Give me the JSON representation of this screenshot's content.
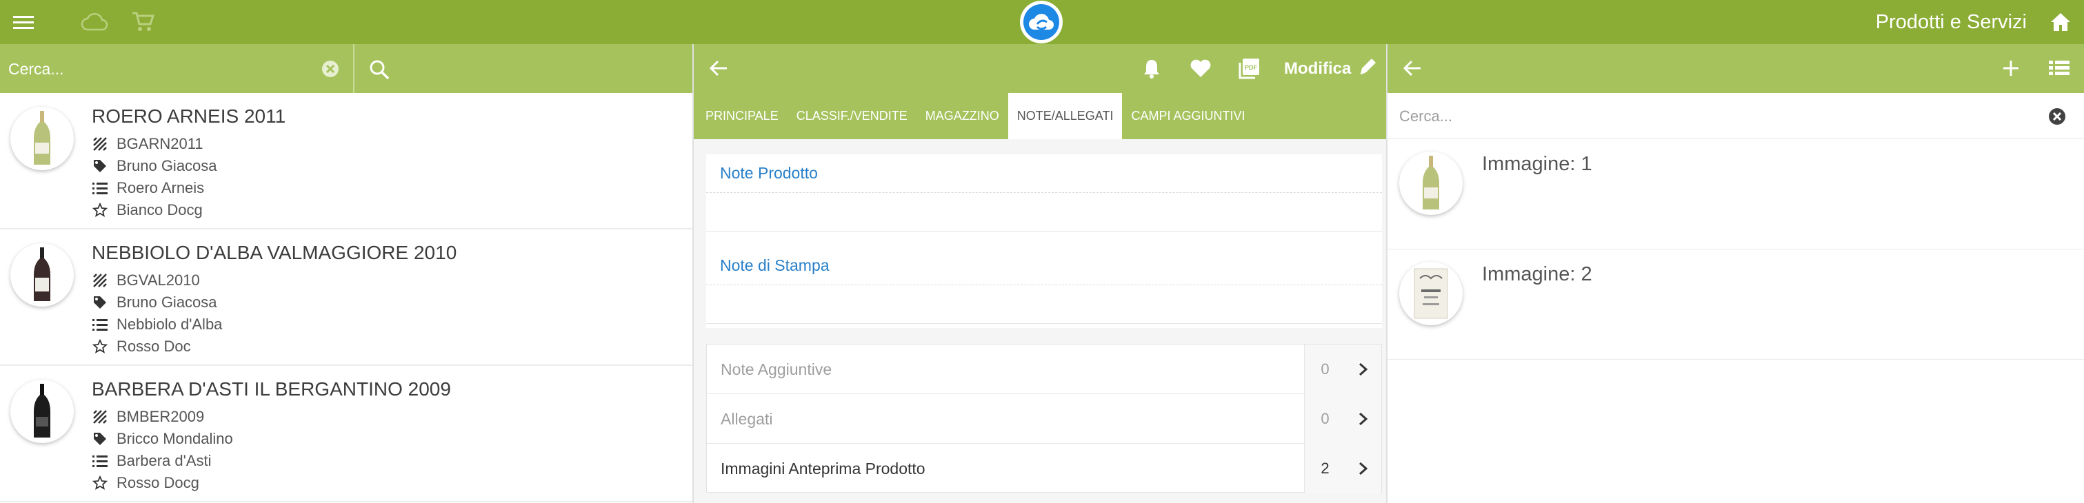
{
  "topbar": {
    "title": "Prodotti e Servizi",
    "icons": [
      "menu-icon",
      "cloud-icon",
      "cart-icon",
      "logo-cloud-icon",
      "home-icon"
    ]
  },
  "left": {
    "search": {
      "placeholder": "Cerca...",
      "value": ""
    },
    "products": [
      {
        "name": "ROERO ARNEIS 2011",
        "code": "BGARN2011",
        "producer": "Bruno Giacosa",
        "category": "Roero Arneis",
        "type": "Bianco Docg",
        "bottle": "white"
      },
      {
        "name": "NEBBIOLO D'ALBA VALMAGGIORE 2010",
        "code": "BGVAL2010",
        "producer": "Bruno Giacosa",
        "category": "Nebbiolo d'Alba",
        "type": "Rosso Doc",
        "bottle": "red"
      },
      {
        "name": "BARBERA D'ASTI IL BERGANTINO 2009",
        "code": "BMBER2009",
        "producer": "Bricco Mondalino",
        "category": "Barbera d'Asti",
        "type": "Rosso Docg",
        "bottle": "dark"
      }
    ]
  },
  "middle": {
    "modifica_label": "Modifica",
    "tabs": [
      {
        "label": "PRINCIPALE",
        "active": false
      },
      {
        "label": "CLASSIF./VENDITE",
        "active": false
      },
      {
        "label": "MAGAZZINO",
        "active": false
      },
      {
        "label": "NOTE/ALLEGATI",
        "active": true
      },
      {
        "label": "CAMPI AGGIUNTIVI",
        "active": false
      }
    ],
    "notes": [
      {
        "heading": "Note Prodotto",
        "content": ""
      },
      {
        "heading": "Note di Stampa",
        "content": ""
      }
    ],
    "extras": [
      {
        "label": "Note Aggiuntive",
        "count": "0",
        "enabled": false
      },
      {
        "label": "Allegati",
        "count": "0",
        "enabled": false
      },
      {
        "label": "Immagini Anteprima Prodotto",
        "count": "2",
        "enabled": true
      }
    ]
  },
  "right": {
    "search": {
      "placeholder": "Cerca...",
      "value": ""
    },
    "images": [
      {
        "label": "Immagine: 1"
      },
      {
        "label": "Immagine: 2"
      }
    ]
  },
  "colors": {
    "topbar": "#8bad35",
    "toolbar": "#a5c25c",
    "link_blue": "#2980c9",
    "logo_blue": "#1e88e5"
  }
}
